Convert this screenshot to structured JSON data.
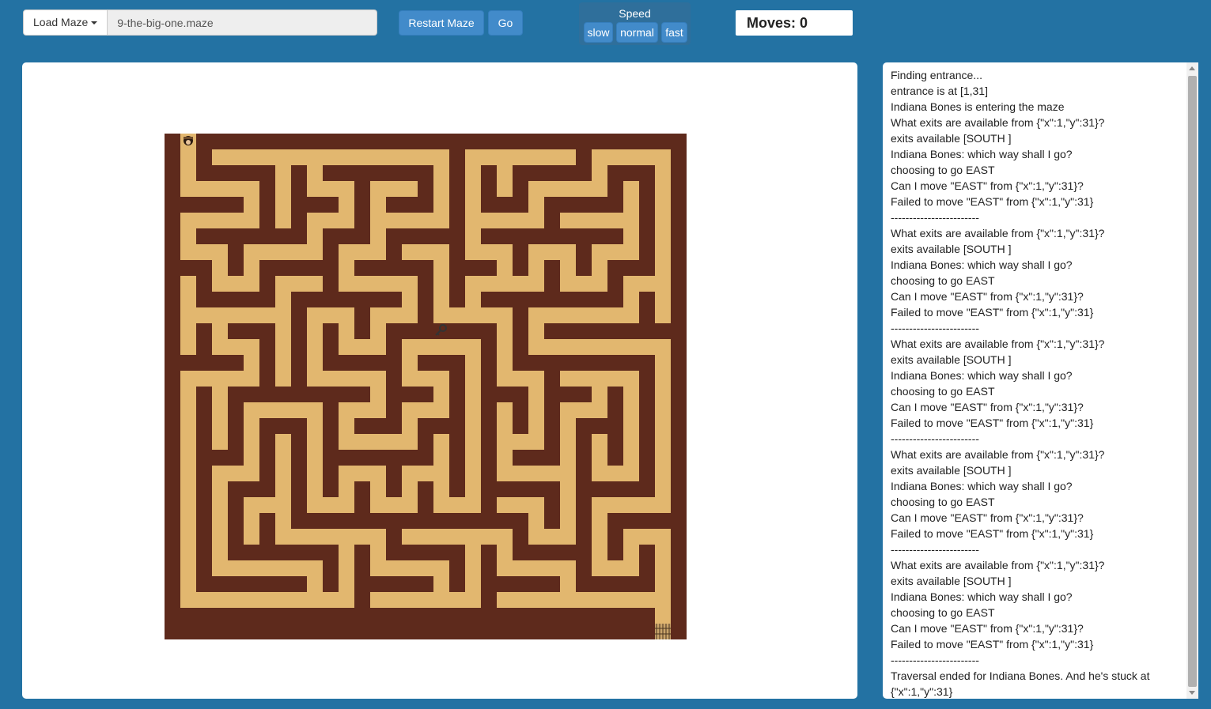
{
  "toolbar": {
    "load_label": "Load Maze",
    "file_value": "9-the-big-one.maze",
    "restart_label": "Restart Maze",
    "go_label": "Go"
  },
  "speed": {
    "label": "Speed",
    "options": [
      "slow",
      "normal",
      "fast"
    ]
  },
  "moves": {
    "text": "Moves: 0"
  },
  "maze": {
    "cols": 33,
    "rows": 32,
    "colors": {
      "wall": "#5e2a1c",
      "path": "#e2b76f"
    },
    "player_icon": "explorer-icon",
    "key_icon": "key-icon",
    "exit_icon": "gate-icon"
  },
  "log": [
    "Finding entrance...",
    "entrance is at [1,31]",
    "Indiana Bones is entering the maze",
    "What exits are available from {\"x\":1,\"y\":31}?",
    "exits available [SOUTH ]",
    "Indiana Bones: which way shall I go?",
    "choosing to go EAST",
    "Can I move \"EAST\" from {\"x\":1,\"y\":31}?",
    "Failed to move \"EAST\" from {\"x\":1,\"y\":31}",
    "------------------------",
    "What exits are available from {\"x\":1,\"y\":31}?",
    "exits available [SOUTH ]",
    "Indiana Bones: which way shall I go?",
    "choosing to go EAST",
    "Can I move \"EAST\" from {\"x\":1,\"y\":31}?",
    "Failed to move \"EAST\" from {\"x\":1,\"y\":31}",
    "------------------------",
    "What exits are available from {\"x\":1,\"y\":31}?",
    "exits available [SOUTH ]",
    "Indiana Bones: which way shall I go?",
    "choosing to go EAST",
    "Can I move \"EAST\" from {\"x\":1,\"y\":31}?",
    "Failed to move \"EAST\" from {\"x\":1,\"y\":31}",
    "------------------------",
    "What exits are available from {\"x\":1,\"y\":31}?",
    "exits available [SOUTH ]",
    "Indiana Bones: which way shall I go?",
    "choosing to go EAST",
    "Can I move \"EAST\" from {\"x\":1,\"y\":31}?",
    "Failed to move \"EAST\" from {\"x\":1,\"y\":31}",
    "------------------------",
    "What exits are available from {\"x\":1,\"y\":31}?",
    "exits available [SOUTH ]",
    "Indiana Bones: which way shall I go?",
    "choosing to go EAST",
    "Can I move \"EAST\" from {\"x\":1,\"y\":31}?",
    "Failed to move \"EAST\" from {\"x\":1,\"y\":31}",
    "------------------------",
    "Traversal ended for Indiana Bones. And he's stuck at {\"x\":1,\"y\":31}"
  ]
}
